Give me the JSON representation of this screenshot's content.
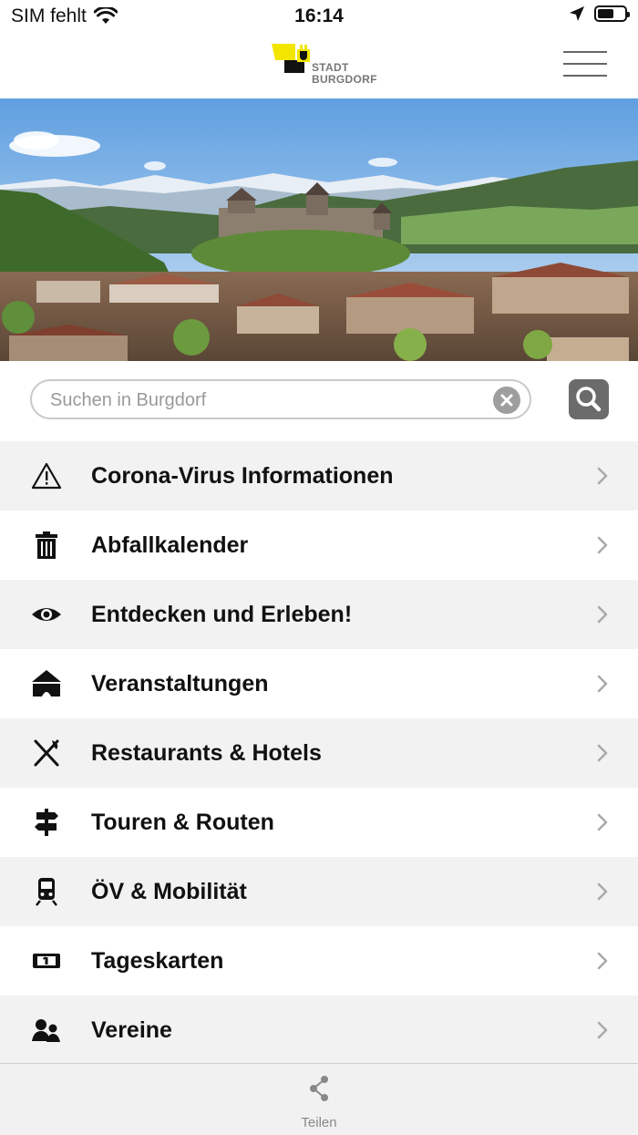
{
  "status_bar": {
    "carrier": "SIM fehlt",
    "time": "16:14",
    "battery_level": 0.6
  },
  "header": {
    "logo_line1": "STADT",
    "logo_line2": "BURGDORF",
    "brand_colors": {
      "yellow": "#f2e600",
      "black": "#111111"
    }
  },
  "search": {
    "placeholder": "Suchen in Burgdorf",
    "value": ""
  },
  "menu_items": [
    {
      "label": "Corona-Virus Informationen",
      "icon": "warning-icon"
    },
    {
      "label": "Abfallkalender",
      "icon": "trash-icon"
    },
    {
      "label": "Entdecken und Erleben!",
      "icon": "eye-icon"
    },
    {
      "label": "Veranstaltungen",
      "icon": "tent-icon"
    },
    {
      "label": "Restaurants & Hotels",
      "icon": "cutlery-icon"
    },
    {
      "label": "Touren & Routen",
      "icon": "signpost-icon"
    },
    {
      "label": "ÖV & Mobilität",
      "icon": "train-icon"
    },
    {
      "label": "Tageskarten",
      "icon": "ticket-icon"
    },
    {
      "label": "Vereine",
      "icon": "people-icon"
    },
    {
      "label": "Neuigkeiten",
      "icon": "news-icon"
    }
  ],
  "tab_bar": {
    "share_label": "Teilen"
  }
}
